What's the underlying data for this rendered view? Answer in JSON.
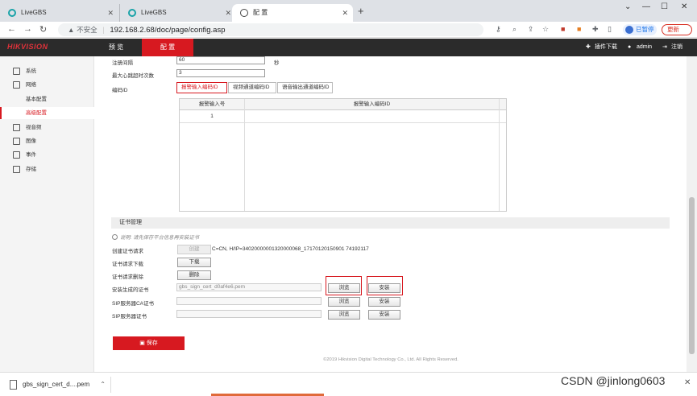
{
  "browser": {
    "tabs": [
      {
        "title": "LiveGBS"
      },
      {
        "title": "LiveGBS"
      },
      {
        "title": "配 置"
      }
    ],
    "address": {
      "security": "不安全",
      "url": "192.168.2.68/doc/page/config.asp"
    },
    "profile_label": "已暂停",
    "update_label": "更新"
  },
  "app": {
    "logo": "HIKVISION",
    "nav": {
      "preview": "预 览",
      "config": "配 置"
    },
    "header_right": {
      "plugin": "插件下载",
      "user": "admin",
      "logout": "注销"
    }
  },
  "sidebar": {
    "items": [
      {
        "label": "系统"
      },
      {
        "label": "网络"
      },
      {
        "label": "基本配置"
      },
      {
        "label": "高级配置"
      },
      {
        "label": "视音频"
      },
      {
        "label": "图像"
      },
      {
        "label": "事件"
      },
      {
        "label": "存储"
      }
    ]
  },
  "form": {
    "register_interval": {
      "label": "注册间隔",
      "value": "60",
      "unit": "秒"
    },
    "max_heartbeat_timeout": {
      "label": "最大心跳超时次数",
      "value": "3"
    },
    "encode_id_label": "编码ID",
    "subtabs": [
      "报警输入编码ID",
      "视频通道编码ID",
      "语音输出通道编码ID"
    ],
    "table": {
      "headers": [
        "报警输入号",
        "报警输入编码ID"
      ],
      "rows": [
        [
          "1",
          ""
        ]
      ]
    }
  },
  "cert": {
    "section_title": "证书管理",
    "notice": "说明: 请先保存平台信息再安装证书",
    "rows": {
      "create_request": {
        "label": "创建证书请求",
        "button": "创建",
        "info": "C=CN, H/IP=34020000001320000068_17170120150901 74192117"
      },
      "download_request": {
        "label": "证书请求下载",
        "button": "下载"
      },
      "delete_request": {
        "label": "证书请求删除",
        "button": "删除"
      },
      "install_generated": {
        "label": "安装生成的证书",
        "file": "gbs_sign_cert_d0af4e6.pem",
        "browse": "浏览",
        "install": "安装"
      },
      "sip_ca": {
        "label": "SIP服务器CA证书",
        "browse": "浏览",
        "install": "安装"
      },
      "sip_server": {
        "label": "SIP服务器证书",
        "browse": "浏览",
        "install": "安装"
      }
    },
    "save_button": "保存"
  },
  "footer": "©2019 Hikvision Digital Technology Co., Ltd. All Rights Reserved.",
  "downloads": {
    "file": "gbs_sign_cert_d....pem"
  },
  "watermark": "CSDN @jinlong0603"
}
